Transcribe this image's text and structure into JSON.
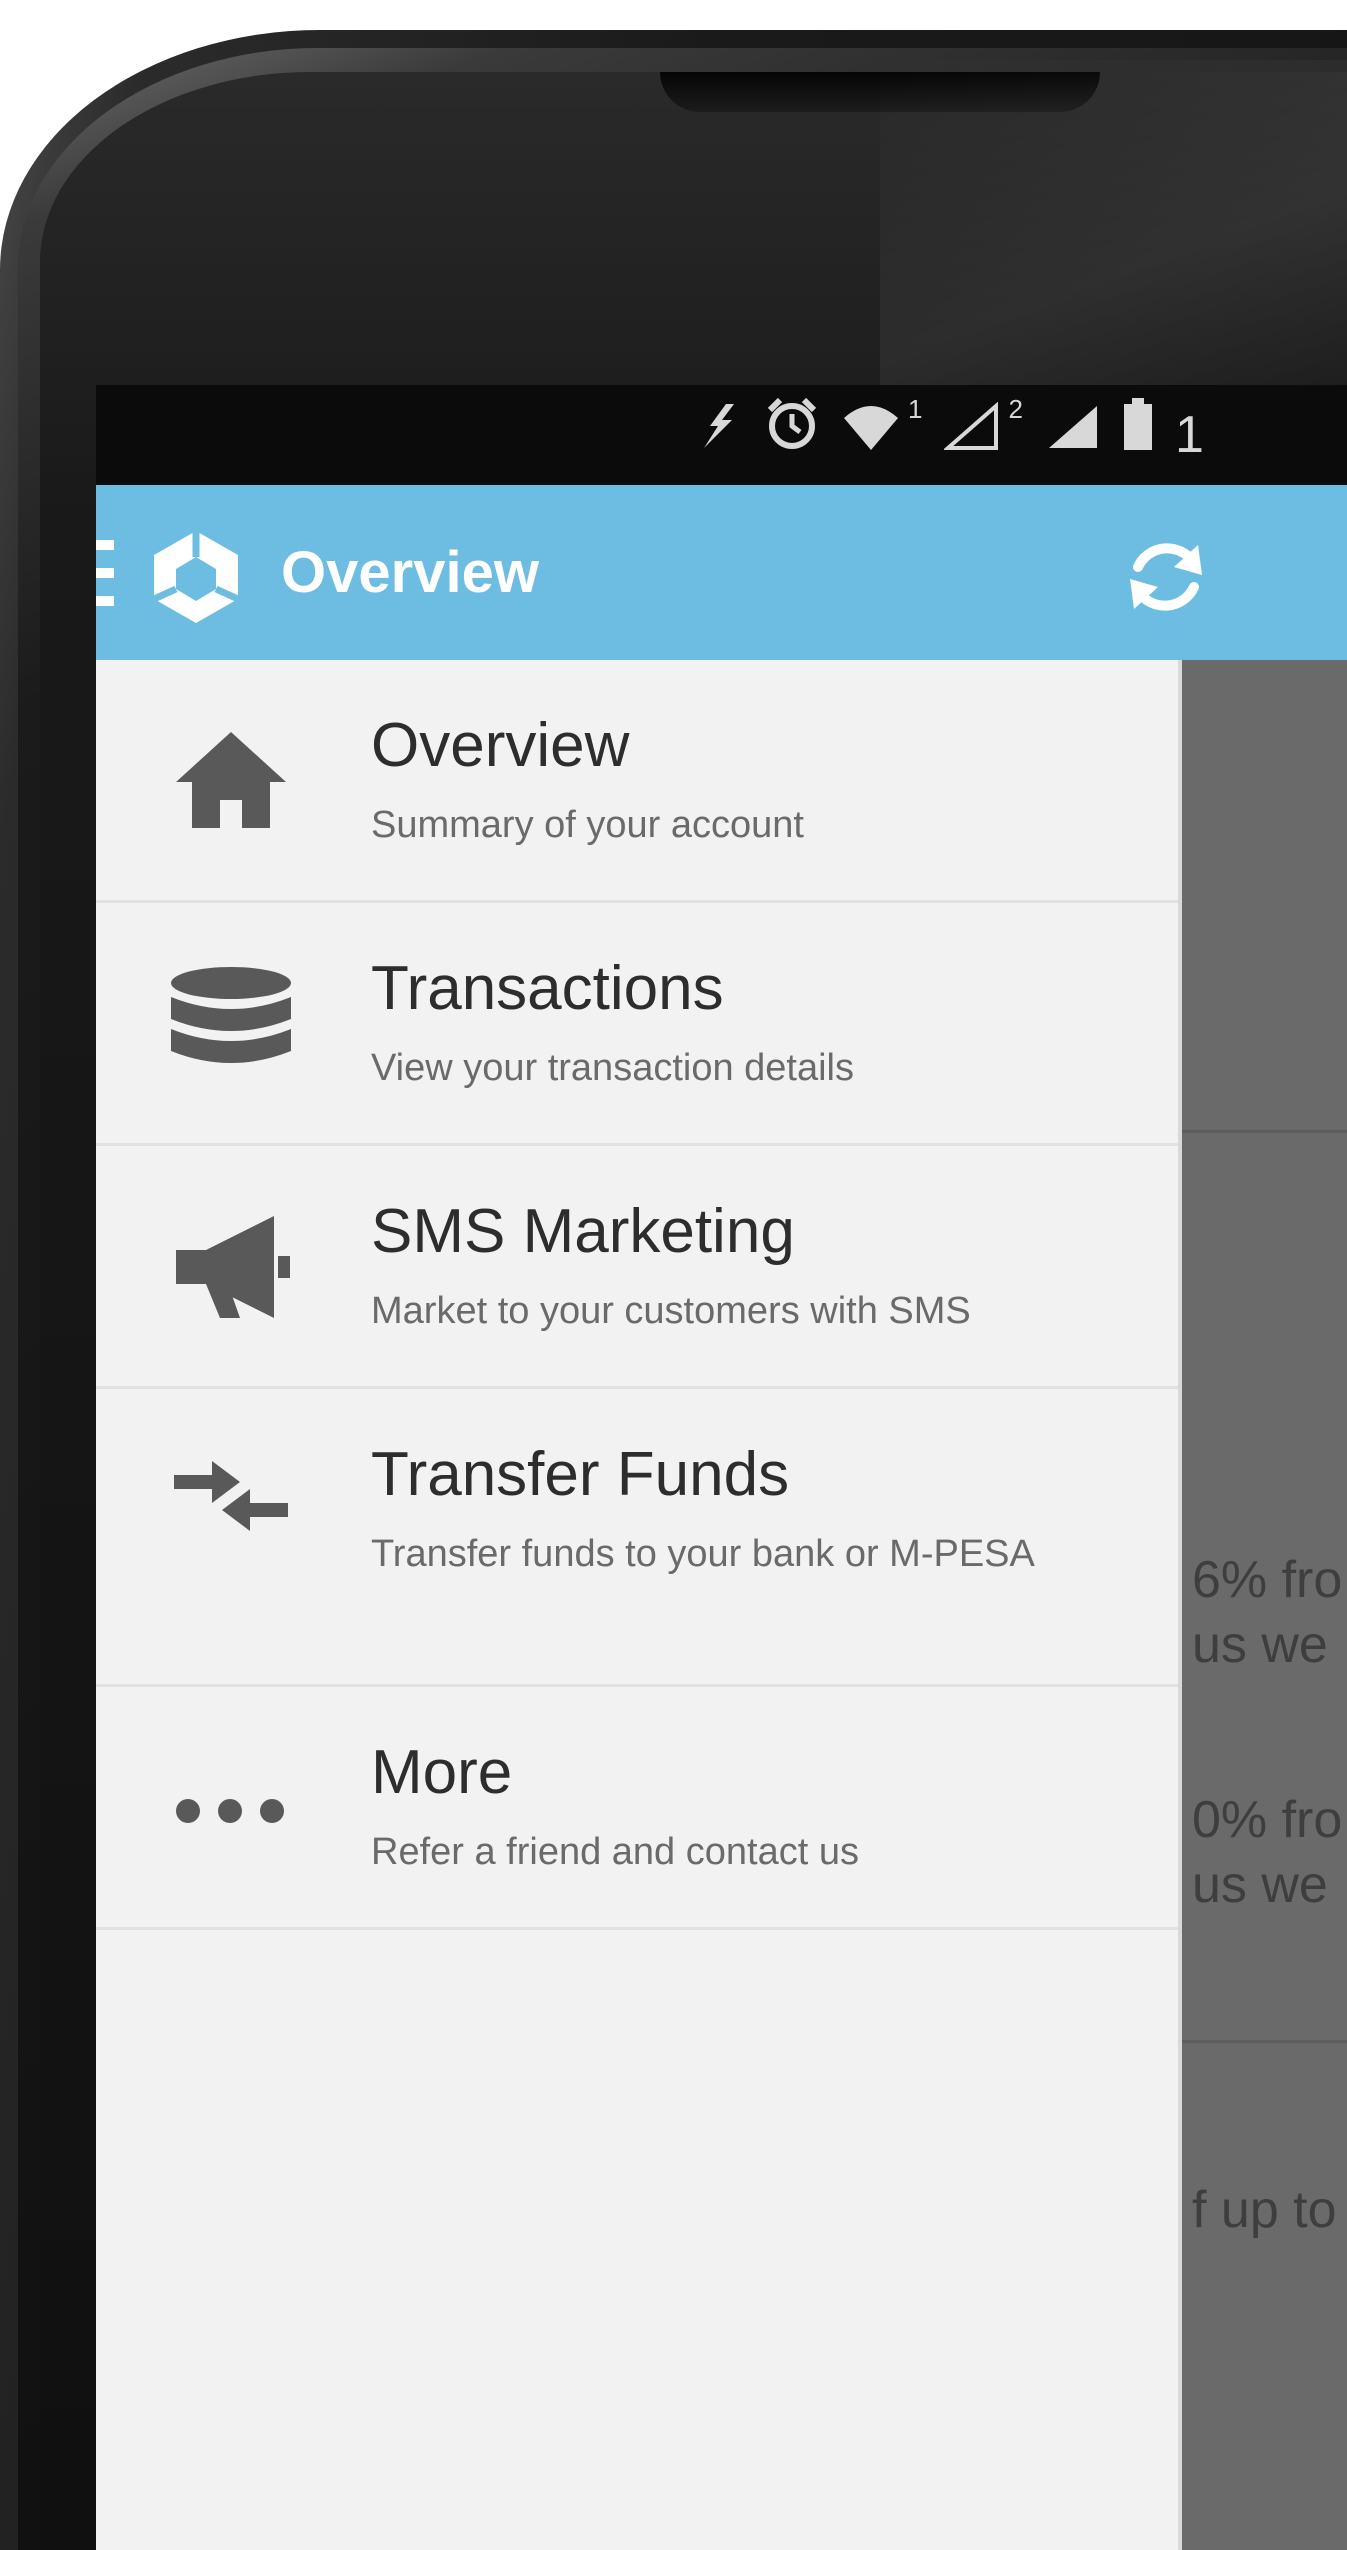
{
  "status_bar": {
    "sim1": "1",
    "sim2": "2",
    "battery_digit": "1"
  },
  "app_bar": {
    "title": "Overview",
    "accent_color": "#6dbde3",
    "refresh_icon": "refresh-icon",
    "logo_icon": "hexagon-logo-icon"
  },
  "drawer": {
    "items": [
      {
        "title": "Overview",
        "subtitle": "Summary of your account",
        "icon": "home-icon"
      },
      {
        "title": "Transactions",
        "subtitle": "View your transaction details",
        "icon": "database-icon"
      },
      {
        "title": "SMS Marketing",
        "subtitle": "Market to your customers with SMS",
        "icon": "megaphone-icon"
      },
      {
        "title": "Transfer Funds",
        "subtitle": "Transfer funds to your bank or M-PESA",
        "icon": "transfer-arrows-icon"
      },
      {
        "title": "More",
        "subtitle": "Refer a friend and contact us",
        "icon": "more-dots-icon"
      }
    ]
  },
  "background_content": {
    "fragment_1a": "6% fro",
    "fragment_1b": "us we",
    "fragment_2a": "0% fro",
    "fragment_2b": "us we",
    "fragment_3": "f up to"
  }
}
